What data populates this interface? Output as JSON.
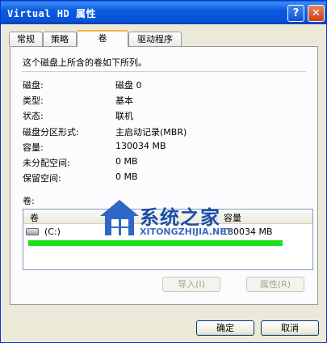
{
  "window": {
    "title": "Virtual HD 属性",
    "help_label": "?",
    "close_label": "✕"
  },
  "tabs": [
    {
      "label": "常规"
    },
    {
      "label": "策略"
    },
    {
      "label": "卷",
      "active": true
    },
    {
      "label": "驱动程序"
    }
  ],
  "panel": {
    "intro": "这个磁盘上所含的卷如下所列。",
    "properties": [
      {
        "label": "磁盘:",
        "value": "磁盘 0"
      },
      {
        "label": "类型:",
        "value": "基本"
      },
      {
        "label": "状态:",
        "value": "联机"
      },
      {
        "label": "磁盘分区形式:",
        "value": "主启动记录(MBR)"
      },
      {
        "label": "容量:",
        "value": "130034 MB"
      },
      {
        "label": "未分配空间:",
        "value": "0 MB"
      },
      {
        "label": "保留空间:",
        "value": "0 MB"
      }
    ],
    "volumes_label": "卷:",
    "columns": [
      "卷",
      "容量"
    ],
    "volumes": [
      {
        "name": "(C:)",
        "capacity": "130034 MB"
      }
    ],
    "import_label": "导入(I)",
    "properties_label": "属性(R)"
  },
  "footer": {
    "ok_label": "确定",
    "cancel_label": "取消"
  },
  "watermark": {
    "brand": "系统之家",
    "domain": "XITONGZHIJIA.NET"
  },
  "colors": {
    "titlebar": "#0a5fd9",
    "highlight_line": "#1be01b",
    "watermark": "#1d4fa8"
  }
}
